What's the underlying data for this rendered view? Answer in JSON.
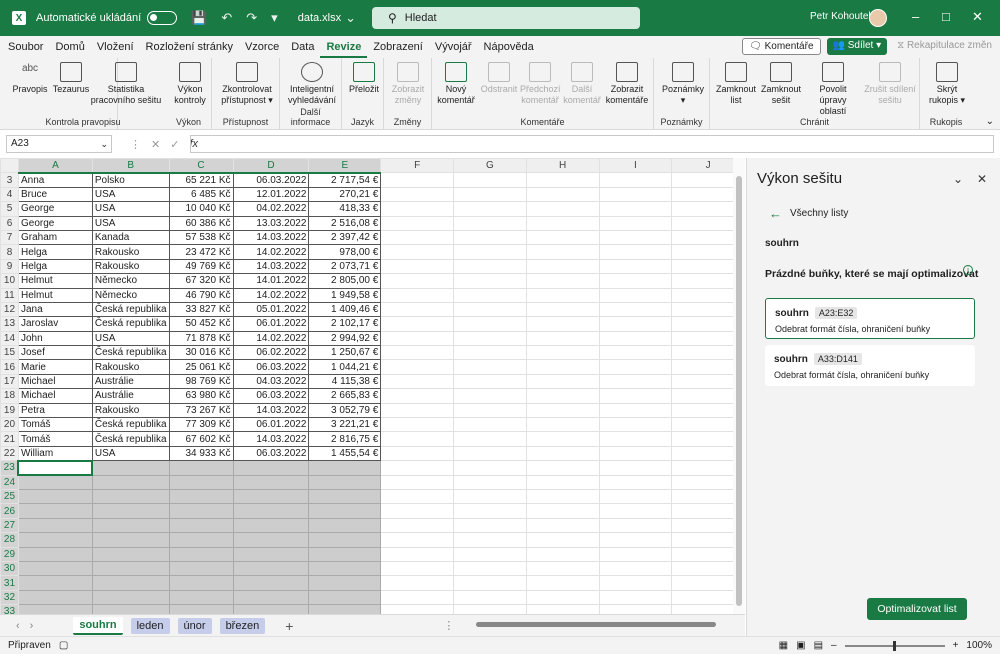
{
  "titlebar": {
    "autosave_label": "Automatické ukládání",
    "filename": "data.xlsx",
    "search_placeholder": "Hledat",
    "user_name": "Petr Kohoutek"
  },
  "menubar": {
    "tabs": [
      "Soubor",
      "Domů",
      "Vložení",
      "Rozložení stránky",
      "Vzorce",
      "Data",
      "Revize",
      "Zobrazení",
      "Vývojář",
      "Nápověda"
    ],
    "active_tab": "Revize",
    "comments_button": "Komentáře",
    "share_button": "Sdílet",
    "recap_button": "Rekapitulace změn"
  },
  "ribbon": {
    "groups": {
      "proofing": "Kontrola pravopisu",
      "performance": "Výkon",
      "accessibility": "Přístupnost",
      "insights": "Další informace",
      "language": "Jazyk",
      "changes": "Změny",
      "comments": "Komentáře",
      "notes": "Poznámky",
      "protect": "Chránit",
      "ink": "Rukopis"
    },
    "buttons": {
      "spelling": "Pravopis",
      "thesaurus": "Tezaurus",
      "stats": "Statistika pracovního sešitu",
      "perf": "Výkon kontroly",
      "check_access": "Zkontrolovat přístupnost",
      "smart_lookup": "Inteligentní vyhledávání",
      "translate": "Přeložit",
      "show_changes": "Zobrazit změny",
      "new_comment": "Nový komentář",
      "delete": "Odstranit",
      "prev_comment": "Předchozí komentář",
      "next_comment": "Další komentář",
      "show_comments": "Zobrazit komentáře",
      "notes": "Poznámky",
      "protect_sheet": "Zamknout list",
      "protect_book": "Zamknout sešit",
      "allow_ranges": "Povolit úpravy oblastí",
      "unshare": "Zrušit sdílení sešitu",
      "hide_ink": "Skrýt rukopis"
    },
    "abc_label": "abc"
  },
  "formula_bar": {
    "name_box": "A23",
    "fx_label": "fx"
  },
  "columns": [
    "A",
    "B",
    "C",
    "D",
    "E",
    "F",
    "G",
    "H",
    "I",
    "J"
  ],
  "rows": [
    {
      "n": "3",
      "name": "Anna",
      "country": "Polsko",
      "amount": "65 221 Kč",
      "date": "06.03.2022",
      "eur": "2 717,54 €"
    },
    {
      "n": "4",
      "name": "Bruce",
      "country": "USA",
      "amount": "6 485 Kč",
      "date": "12.01.2022",
      "eur": "270,21 €"
    },
    {
      "n": "5",
      "name": "George",
      "country": "USA",
      "amount": "10 040 Kč",
      "date": "04.02.2022",
      "eur": "418,33 €"
    },
    {
      "n": "6",
      "name": "George",
      "country": "USA",
      "amount": "60 386 Kč",
      "date": "13.03.2022",
      "eur": "2 516,08 €"
    },
    {
      "n": "7",
      "name": "Graham",
      "country": "Kanada",
      "amount": "57 538 Kč",
      "date": "14.03.2022",
      "eur": "2 397,42 €"
    },
    {
      "n": "8",
      "name": "Helga",
      "country": "Rakousko",
      "amount": "23 472 Kč",
      "date": "14.02.2022",
      "eur": "978,00 €"
    },
    {
      "n": "9",
      "name": "Helga",
      "country": "Rakousko",
      "amount": "49 769 Kč",
      "date": "14.03.2022",
      "eur": "2 073,71 €"
    },
    {
      "n": "10",
      "name": "Helmut",
      "country": "Německo",
      "amount": "67 320 Kč",
      "date": "14.01.2022",
      "eur": "2 805,00 €"
    },
    {
      "n": "11",
      "name": "Helmut",
      "country": "Německo",
      "amount": "46 790 Kč",
      "date": "14.02.2022",
      "eur": "1 949,58 €"
    },
    {
      "n": "12",
      "name": "Jana",
      "country": "Česká republika",
      "amount": "33 827 Kč",
      "date": "05.01.2022",
      "eur": "1 409,46 €"
    },
    {
      "n": "13",
      "name": "Jaroslav",
      "country": "Česká republika",
      "amount": "50 452 Kč",
      "date": "06.01.2022",
      "eur": "2 102,17 €"
    },
    {
      "n": "14",
      "name": "John",
      "country": "USA",
      "amount": "71 878 Kč",
      "date": "14.02.2022",
      "eur": "2 994,92 €"
    },
    {
      "n": "15",
      "name": "Josef",
      "country": "Česká republika",
      "amount": "30 016 Kč",
      "date": "06.02.2022",
      "eur": "1 250,67 €"
    },
    {
      "n": "16",
      "name": "Marie",
      "country": "Rakousko",
      "amount": "25 061 Kč",
      "date": "06.03.2022",
      "eur": "1 044,21 €"
    },
    {
      "n": "17",
      "name": "Michael",
      "country": "Austrálie",
      "amount": "98 769 Kč",
      "date": "04.03.2022",
      "eur": "4 115,38 €"
    },
    {
      "n": "18",
      "name": "Michael",
      "country": "Austrálie",
      "amount": "63 980 Kč",
      "date": "06.03.2022",
      "eur": "2 665,83 €"
    },
    {
      "n": "19",
      "name": "Petra",
      "country": "Rakousko",
      "amount": "73 267 Kč",
      "date": "14.03.2022",
      "eur": "3 052,79 €"
    },
    {
      "n": "20",
      "name": "Tomáš",
      "country": "Česká republika",
      "amount": "77 309 Kč",
      "date": "06.01.2022",
      "eur": "3 221,21 €"
    },
    {
      "n": "21",
      "name": "Tomáš",
      "country": "Česká republika",
      "amount": "67 602 Kč",
      "date": "14.03.2022",
      "eur": "2 816,75 €"
    },
    {
      "n": "22",
      "name": "William",
      "country": "USA",
      "amount": "34 933 Kč",
      "date": "06.03.2022",
      "eur": "1 455,54 €"
    }
  ],
  "empty_rows": [
    "23",
    "24",
    "25",
    "26",
    "27",
    "28",
    "29",
    "30",
    "31",
    "32",
    "33"
  ],
  "sheets": [
    "souhrn",
    "leden",
    "únor",
    "březen"
  ],
  "active_sheet": "souhrn",
  "status": {
    "ready": "Připraven",
    "zoom": "100%"
  },
  "panel": {
    "title": "Výkon sešitu",
    "back_label": "Všechny listy",
    "sheet_name": "souhrn",
    "heading": "Prázdné buňky, které se mají optimalizovat",
    "cards": [
      {
        "sheet": "souhrn",
        "range": "A23:E32",
        "desc": "Odebrat formát čísla, ohraničení buňky",
        "selected": true
      },
      {
        "sheet": "souhrn",
        "range": "A33:D141",
        "desc": "Odebrat formát čísla, ohraničení buňky",
        "selected": false
      }
    ],
    "optimize_button": "Optimalizovat list"
  },
  "colors": {
    "accent": "#1a7a43",
    "sheet_tab_bg": "#c6cdea",
    "empty_range": "#cdcdcd"
  }
}
